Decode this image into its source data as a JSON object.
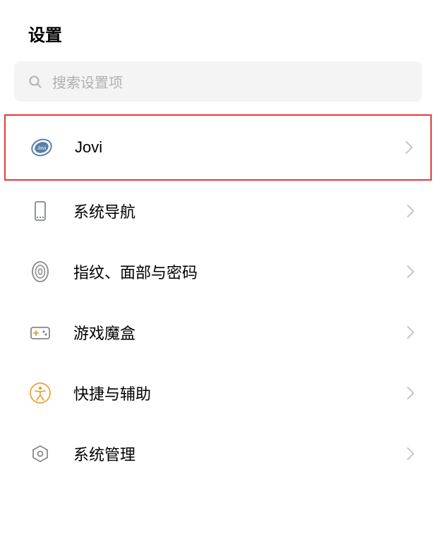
{
  "header": {
    "title": "设置"
  },
  "search": {
    "placeholder": "搜索设置项"
  },
  "items": [
    {
      "label": "Jovi",
      "highlighted": true
    },
    {
      "label": "系统导航",
      "highlighted": false
    },
    {
      "label": "指纹、面部与密码",
      "highlighted": false
    },
    {
      "label": "游戏魔盒",
      "highlighted": false
    },
    {
      "label": "快捷与辅助",
      "highlighted": false
    },
    {
      "label": "系统管理",
      "highlighted": false
    }
  ]
}
